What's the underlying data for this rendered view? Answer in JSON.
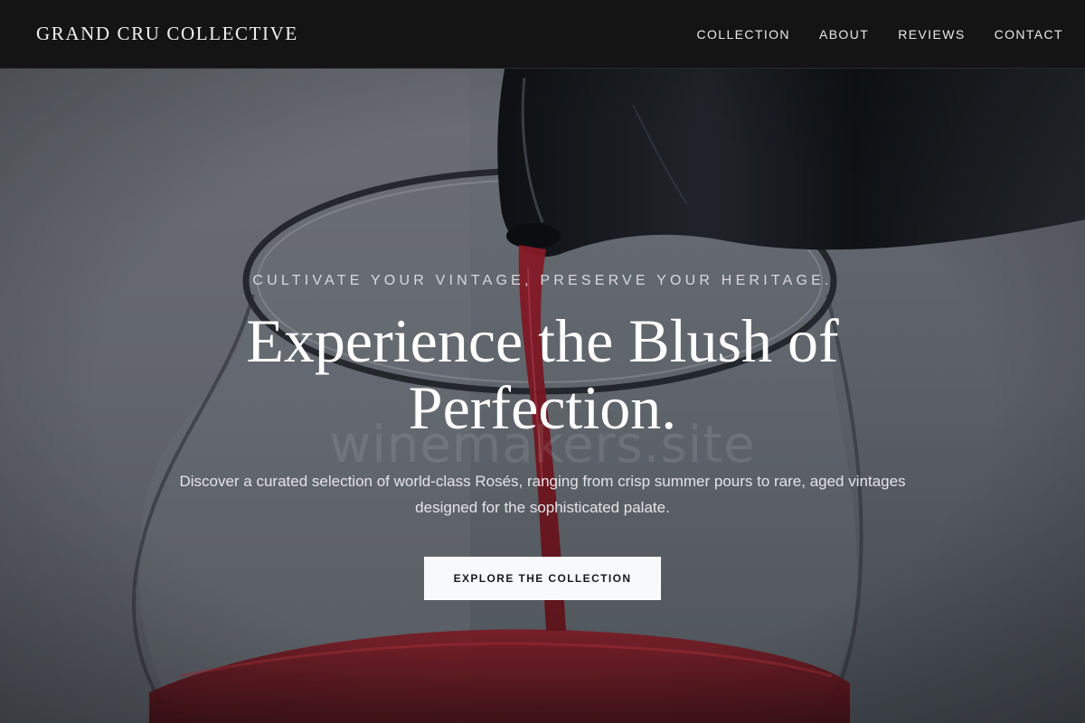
{
  "header": {
    "brand": "GRAND CRU COLLECTIVE",
    "nav": [
      {
        "label": "COLLECTION"
      },
      {
        "label": "ABOUT"
      },
      {
        "label": "REVIEWS"
      },
      {
        "label": "CONTACT"
      }
    ]
  },
  "hero": {
    "eyebrow": "CULTIVATE YOUR VINTAGE, PRESERVE YOUR HERITAGE.",
    "headline_line1": "Experience the Blush of",
    "headline_line2": "Perfection.",
    "subtext": "Discover a curated selection of world-class Rosés, ranging from crisp summer pours to rare, aged vintages designed for the sophisticated palate.",
    "cta_label": "EXPLORE THE COLLECTION",
    "watermark": "winemakers.site"
  },
  "colors": {
    "header_bg": "#141414",
    "cta_bg": "#f8f9fb",
    "wine_red": "#8a1a24"
  }
}
